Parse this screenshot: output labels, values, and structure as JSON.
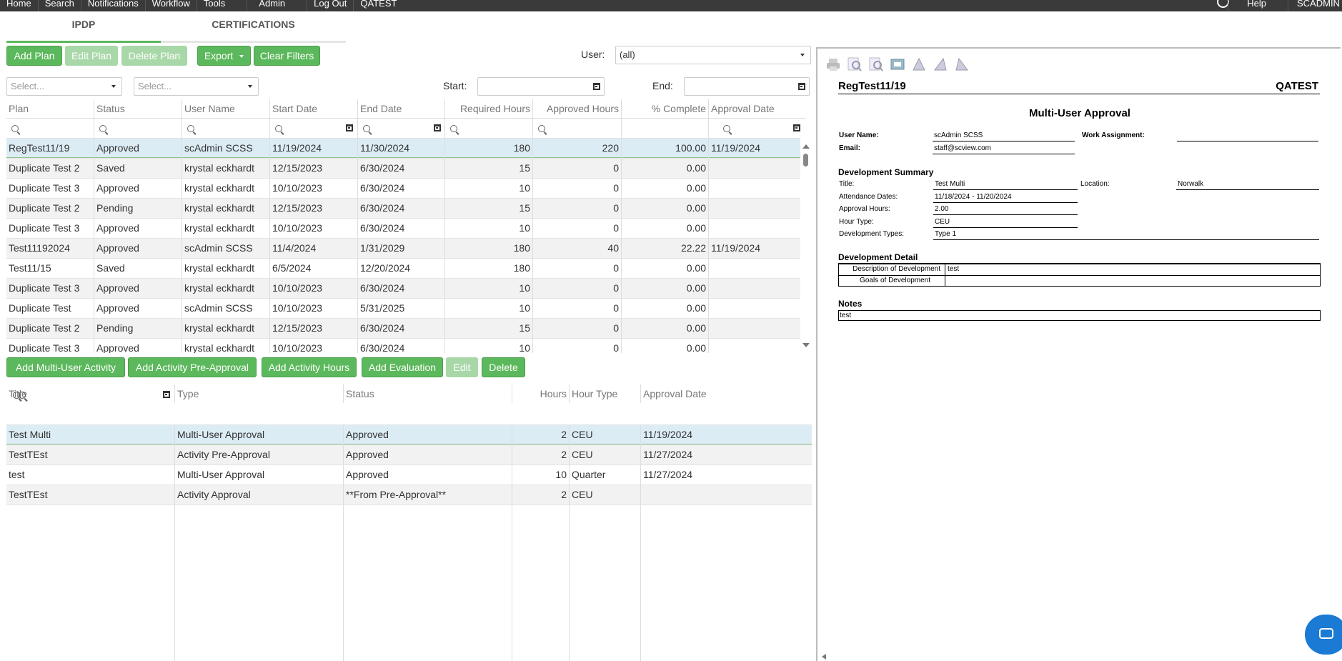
{
  "topbar": {
    "nav": [
      "Home",
      "Search",
      "Notifications",
      "Workflow",
      "Tools",
      "Admin",
      "Log Out",
      "QATEST"
    ],
    "right": [
      "Help",
      "SCADMIN"
    ]
  },
  "tabs": [
    "IPDP",
    "CERTIFICATIONS"
  ],
  "toolbar": {
    "add_plan": "Add Plan",
    "edit_plan": "Edit Plan",
    "delete_plan": "Delete Plan",
    "export": "Export",
    "clear_filters": "Clear Filters",
    "user_label": "User:",
    "user_value": "(all)",
    "select_placeholder": "Select...",
    "start_label": "Start:",
    "end_label": "End:"
  },
  "plans": {
    "columns": [
      "Plan",
      "Status",
      "User Name",
      "Start Date",
      "End Date",
      "Required Hours",
      "Approved Hours",
      "% Complete",
      "Approval Date"
    ],
    "rows": [
      [
        "RegTest11/19",
        "Approved",
        "scAdmin SCSS",
        "11/19/2024",
        "11/30/2024",
        "180",
        "220",
        "100.00",
        "11/19/2024"
      ],
      [
        "Duplicate Test 2",
        "Saved",
        "krystal eckhardt",
        "12/15/2023",
        "6/30/2024",
        "15",
        "0",
        "0.00",
        ""
      ],
      [
        "Duplicate Test 3",
        "Approved",
        "krystal eckhardt",
        "10/10/2023",
        "6/30/2024",
        "10",
        "0",
        "0.00",
        ""
      ],
      [
        "Duplicate Test 2",
        "Pending",
        "krystal eckhardt",
        "12/15/2023",
        "6/30/2024",
        "15",
        "0",
        "0.00",
        ""
      ],
      [
        "Duplicate Test 3",
        "Approved",
        "krystal eckhardt",
        "10/10/2023",
        "6/30/2024",
        "10",
        "0",
        "0.00",
        ""
      ],
      [
        "Test11192024",
        "Approved",
        "scAdmin SCSS",
        "11/4/2024",
        "1/31/2029",
        "180",
        "40",
        "22.22",
        "11/19/2024"
      ],
      [
        "Test11/15",
        "Saved",
        "krystal eckhardt",
        "6/5/2024",
        "12/20/2024",
        "180",
        "0",
        "0.00",
        ""
      ],
      [
        "Duplicate Test 3",
        "Approved",
        "krystal eckhardt",
        "10/10/2023",
        "6/30/2024",
        "10",
        "0",
        "0.00",
        ""
      ],
      [
        "Duplicate Test",
        "Approved",
        "scAdmin SCSS",
        "10/10/2023",
        "5/31/2025",
        "10",
        "0",
        "0.00",
        ""
      ],
      [
        "Duplicate Test 2",
        "Pending",
        "krystal eckhardt",
        "12/15/2023",
        "6/30/2024",
        "15",
        "0",
        "0.00",
        ""
      ],
      [
        "Duplicate Test 3",
        "Approved",
        "krystal eckhardt",
        "10/10/2023",
        "6/30/2024",
        "10",
        "0",
        "0.00",
        ""
      ]
    ]
  },
  "activity_toolbar": {
    "add_multi": "Add Multi-User Activity",
    "add_pre": "Add Activity Pre-Approval",
    "add_hours": "Add Activity Hours",
    "add_eval": "Add Evaluation",
    "edit": "Edit",
    "delete": "Delete"
  },
  "activities": {
    "columns": [
      "Title",
      "Type",
      "Status",
      "Hours",
      "Hour Type",
      "Approval Date"
    ],
    "rows": [
      [
        "Test Multi",
        "Multi-User Approval",
        "Approved",
        "2",
        "CEU",
        "11/19/2024"
      ],
      [
        "TestTEst",
        "Activity Pre-Approval",
        "Approved",
        "2",
        "CEU",
        "11/27/2024"
      ],
      [
        "test",
        "Multi-User Approval",
        "Approved",
        "10",
        "Quarter",
        "11/27/2024"
      ],
      [
        "TestTEst",
        "Activity Approval",
        "**From Pre-Approval**",
        "2",
        "CEU",
        ""
      ]
    ]
  },
  "report": {
    "plan_name": "RegTest11/19",
    "org": "QATEST",
    "title": "Multi-User Approval",
    "user_name_label": "User Name:",
    "user_name": "scAdmin SCSS",
    "work_assignment_label": "Work Assignment:",
    "email_label": "Email:",
    "email": "staff@scview.com",
    "dev_summary": "Development Summary",
    "title_label": "Title:",
    "title_value": "Test Multi",
    "location_label": "Location:",
    "location_value": "Norwalk",
    "attendance_label": "Attendance Dates:",
    "attendance_value": "11/18/2024 - 11/20/2024",
    "approval_hours_label": "Approval Hours:",
    "approval_hours_value": "2.00",
    "hour_type_label": "Hour Type:",
    "hour_type_value": "CEU",
    "dev_types_label": "Development Types:",
    "dev_types_value": "Type 1",
    "dev_detail": "Development Detail",
    "desc_label": "Description of Development",
    "desc_value": "test",
    "goals_label": "Goals of Development",
    "notes_label": "Notes",
    "notes_value": "test"
  }
}
